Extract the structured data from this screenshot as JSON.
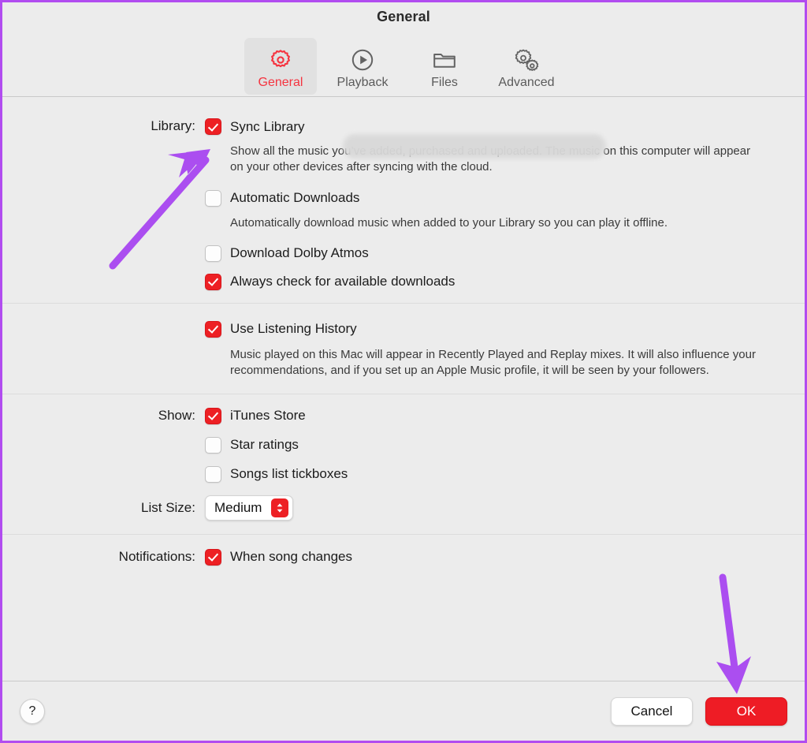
{
  "window": {
    "title": "General"
  },
  "toolbar": {
    "tabs": [
      {
        "label": "General",
        "icon": "gear-icon",
        "selected": true
      },
      {
        "label": "Playback",
        "icon": "play-circle-icon",
        "selected": false
      },
      {
        "label": "Files",
        "icon": "folder-icon",
        "selected": false
      },
      {
        "label": "Advanced",
        "icon": "double-gear-icon",
        "selected": false
      }
    ]
  },
  "sections": {
    "library": {
      "label": "Library:",
      "sync_library": {
        "label": "Sync Library",
        "checked": true,
        "description": "Show all the music you’ve added, purchased and uploaded. The music on this computer will appear on your other devices after syncing with the cloud."
      },
      "automatic_downloads": {
        "label": "Automatic Downloads",
        "checked": false,
        "description": "Automatically download music when added to your Library so you can play it offline."
      },
      "dolby_atmos": {
        "label": "Download Dolby Atmos",
        "checked": false
      },
      "always_check": {
        "label": "Always check for available downloads",
        "checked": true
      }
    },
    "listening_history": {
      "label": "Use Listening History",
      "checked": true,
      "description": "Music played on this Mac will appear in Recently Played and Replay mixes. It will also influence your recommendations, and if you set up an Apple Music profile, it will be seen by your followers."
    },
    "show": {
      "label": "Show:",
      "items": [
        {
          "label": "iTunes Store",
          "checked": true
        },
        {
          "label": "Star ratings",
          "checked": false
        },
        {
          "label": "Songs list tickboxes",
          "checked": false
        }
      ]
    },
    "list_size": {
      "label": "List Size:",
      "value": "Medium"
    },
    "notifications": {
      "label": "Notifications:",
      "item": {
        "label": "When song changes",
        "checked": true
      }
    }
  },
  "footer": {
    "help_label": "?",
    "cancel_label": "Cancel",
    "ok_label": "OK"
  },
  "annotations": {
    "arrow_color": "#ab4ef0",
    "arrows": [
      {
        "name": "arrow-to-sync-library-checkbox"
      },
      {
        "name": "arrow-to-ok-button"
      }
    ]
  },
  "colors": {
    "accent_red": "#ed2024",
    "border_purple": "#b14cf0",
    "window_background": "#ececec"
  }
}
